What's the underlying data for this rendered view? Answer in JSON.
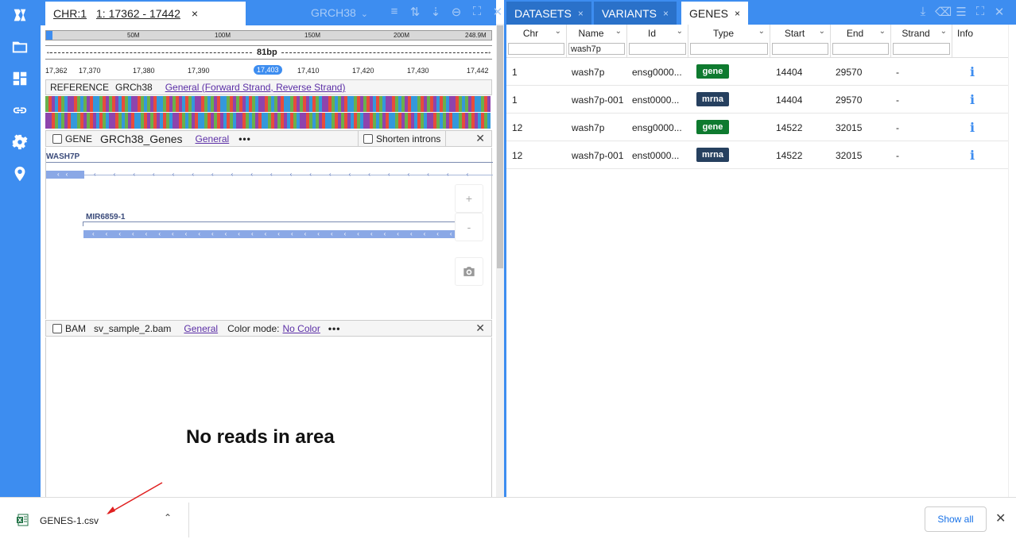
{
  "nav": {
    "items": [
      {
        "icon": "logo-icon"
      },
      {
        "icon": "folder-icon"
      },
      {
        "icon": "dashboard-icon"
      },
      {
        "icon": "link-icon"
      },
      {
        "icon": "gear-icon"
      },
      {
        "icon": "location-pin-icon"
      }
    ]
  },
  "browser": {
    "tab": {
      "chr": "CHR:1",
      "range": "1: 17362 - 17442",
      "close": "×"
    },
    "reference_select": "GRCH38",
    "ruler_marks": [
      "50M",
      "100M",
      "150M",
      "200M",
      "248.9M"
    ],
    "span_label": "81bp",
    "position_ticks": [
      "17,362",
      "17,370",
      "17,380",
      "17,390",
      "17,403",
      "17,410",
      "17,420",
      "17,430",
      "17,442"
    ],
    "current_position": "17,403",
    "reference_track": {
      "label": "REFERENCE",
      "name": "GRCh38",
      "menu": "General (Forward Strand, Reverse Strand)"
    },
    "gene_track": {
      "type": "GENE",
      "name": "GRCh38_Genes",
      "menu": "General",
      "more": "•••",
      "shorten_introns": "Shorten introns",
      "close": "✕"
    },
    "genes": [
      {
        "name": "WASH7P"
      },
      {
        "name": "MIR6859-1"
      }
    ],
    "zoom_in": "+",
    "zoom_out": "-",
    "bam_track": {
      "type": "BAM",
      "name": "sv_sample_2.bam",
      "menu": "General",
      "color_mode_label": "Color mode:",
      "color_mode_value": "No Color",
      "more": "•••",
      "close": "✕"
    },
    "no_reads": "No reads in area"
  },
  "right_panel": {
    "tabs": [
      {
        "label": "DATASETS",
        "close": "×"
      },
      {
        "label": "VARIANTS",
        "close": "×"
      },
      {
        "label": "GENES",
        "close": "×",
        "active": true
      }
    ]
  },
  "genes_table": {
    "columns": [
      "Chr",
      "Name",
      "Id",
      "Type",
      "Start",
      "End",
      "Strand",
      "Info"
    ],
    "filters": {
      "name": "wash7p"
    },
    "rows": [
      {
        "chr": "1",
        "name": "wash7p",
        "id": "ensg0000...",
        "type": "gene",
        "start": "14404",
        "end": "29570",
        "strand": "-"
      },
      {
        "chr": "1",
        "name": "wash7p-001",
        "id": "enst0000...",
        "type": "mrna",
        "start": "14404",
        "end": "29570",
        "strand": "-"
      },
      {
        "chr": "12",
        "name": "wash7p",
        "id": "ensg0000...",
        "type": "gene",
        "start": "14522",
        "end": "32015",
        "strand": "-"
      },
      {
        "chr": "12",
        "name": "wash7p-001",
        "id": "enst0000...",
        "type": "mrna",
        "start": "14522",
        "end": "32015",
        "strand": "-"
      }
    ],
    "info_icon": "i"
  },
  "download_bar": {
    "file_name": "GENES-1.csv",
    "file_icon": "excel-file-icon",
    "show_all": "Show all",
    "close": "✕"
  },
  "colors": {
    "accent": "#3d8df0",
    "gene_tag": "#0e7a2f",
    "mrna_tag": "#26405f",
    "nucleotides": [
      "#6ab04c",
      "#e74c3c",
      "#8e44ad",
      "#3498db"
    ]
  }
}
